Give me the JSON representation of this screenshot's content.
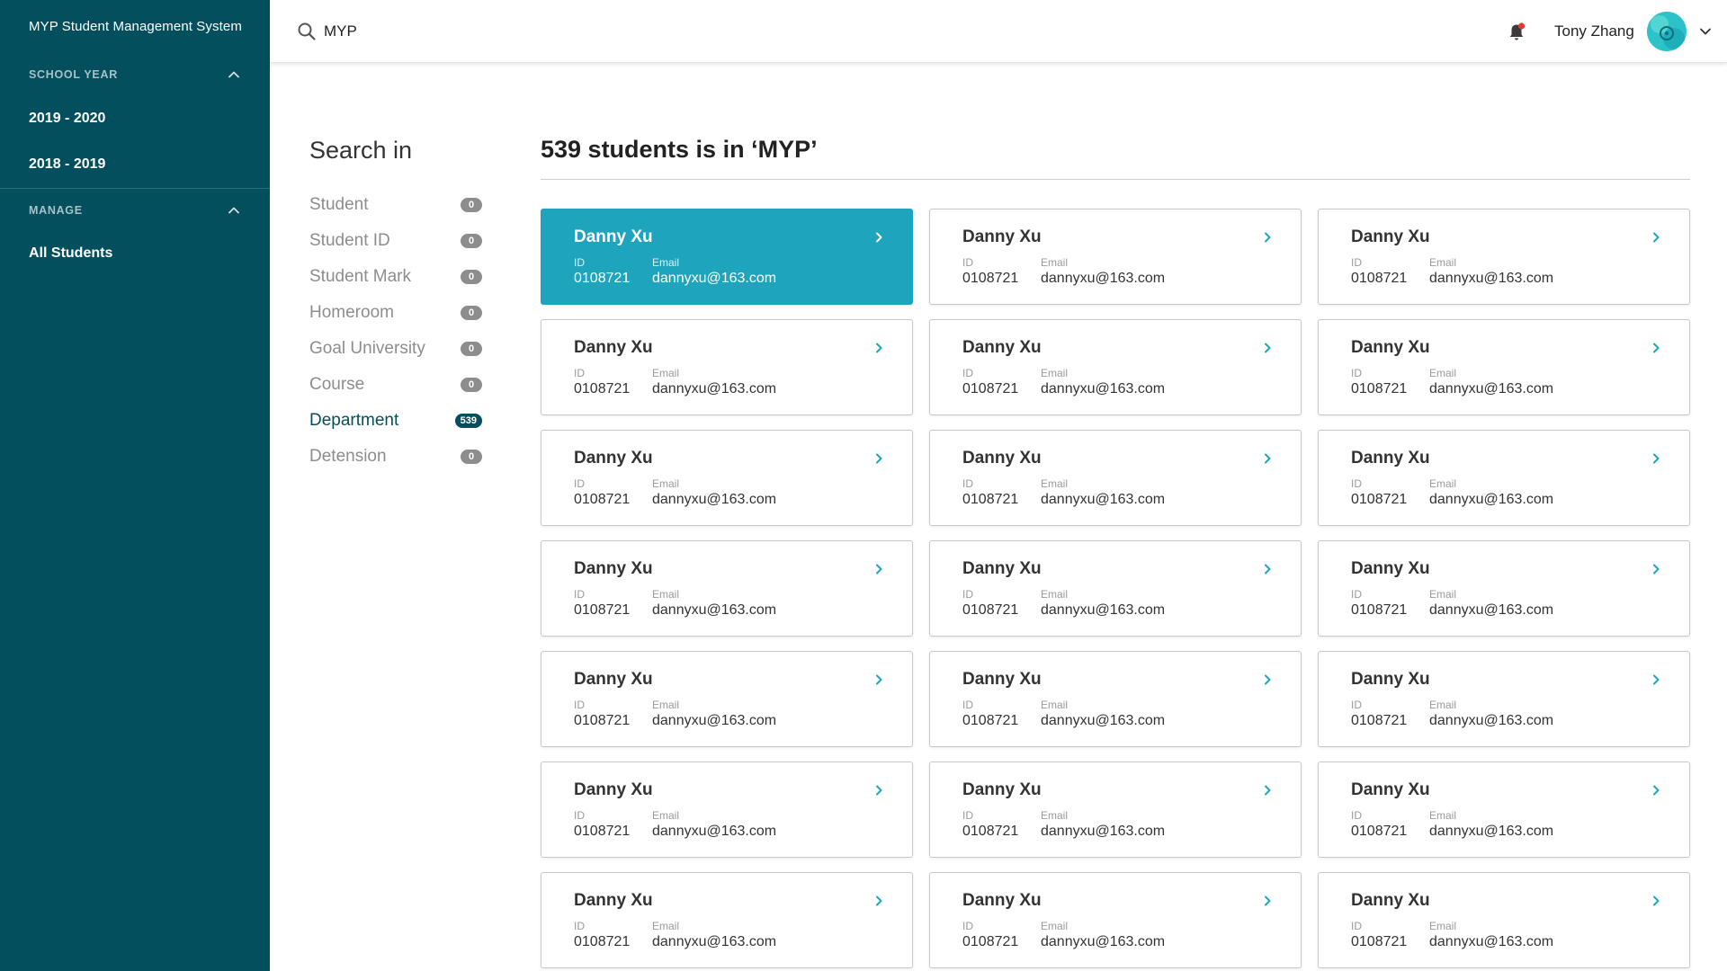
{
  "app": {
    "title": "MYP Student Management System"
  },
  "sidebar": {
    "school_year": {
      "label": "SCHOOL YEAR",
      "items": [
        "2019 - 2020",
        "2018 - 2019"
      ]
    },
    "manage": {
      "label": "MANAGE",
      "items": [
        "All Students"
      ]
    }
  },
  "header": {
    "search_value": "MYP",
    "user_name": "Tony Zhang",
    "notification_dot_color": "#e53935"
  },
  "search_in": {
    "title": "Search in",
    "filters": [
      {
        "label": "Student",
        "count": "0"
      },
      {
        "label": "Student ID",
        "count": "0"
      },
      {
        "label": "Student Mark",
        "count": "0"
      },
      {
        "label": "Homeroom",
        "count": "0"
      },
      {
        "label": "Goal University",
        "count": "0"
      },
      {
        "label": "Course",
        "count": "0"
      },
      {
        "label": "Department",
        "count": "539",
        "active": true
      },
      {
        "label": "Detension",
        "count": "0"
      }
    ]
  },
  "results": {
    "title": "539 students is in ‘MYP’",
    "id_label": "ID",
    "email_label": "Email",
    "students": [
      {
        "name": "Danny Xu",
        "id": "0108721",
        "email": "dannyxu@163.com",
        "selected": true
      },
      {
        "name": "Danny Xu",
        "id": "0108721",
        "email": "dannyxu@163.com"
      },
      {
        "name": "Danny Xu",
        "id": "0108721",
        "email": "dannyxu@163.com"
      },
      {
        "name": "Danny Xu",
        "id": "0108721",
        "email": "dannyxu@163.com"
      },
      {
        "name": "Danny Xu",
        "id": "0108721",
        "email": "dannyxu@163.com"
      },
      {
        "name": "Danny Xu",
        "id": "0108721",
        "email": "dannyxu@163.com"
      },
      {
        "name": "Danny Xu",
        "id": "0108721",
        "email": "dannyxu@163.com"
      },
      {
        "name": "Danny Xu",
        "id": "0108721",
        "email": "dannyxu@163.com"
      },
      {
        "name": "Danny Xu",
        "id": "0108721",
        "email": "dannyxu@163.com"
      },
      {
        "name": "Danny Xu",
        "id": "0108721",
        "email": "dannyxu@163.com"
      },
      {
        "name": "Danny Xu",
        "id": "0108721",
        "email": "dannyxu@163.com"
      },
      {
        "name": "Danny Xu",
        "id": "0108721",
        "email": "dannyxu@163.com"
      },
      {
        "name": "Danny Xu",
        "id": "0108721",
        "email": "dannyxu@163.com"
      },
      {
        "name": "Danny Xu",
        "id": "0108721",
        "email": "dannyxu@163.com"
      },
      {
        "name": "Danny Xu",
        "id": "0108721",
        "email": "dannyxu@163.com"
      },
      {
        "name": "Danny Xu",
        "id": "0108721",
        "email": "dannyxu@163.com"
      },
      {
        "name": "Danny Xu",
        "id": "0108721",
        "email": "dannyxu@163.com"
      },
      {
        "name": "Danny Xu",
        "id": "0108721",
        "email": "dannyxu@163.com"
      },
      {
        "name": "Danny Xu",
        "id": "0108721",
        "email": "dannyxu@163.com"
      },
      {
        "name": "Danny Xu",
        "id": "0108721",
        "email": "dannyxu@163.com"
      },
      {
        "name": "Danny Xu",
        "id": "0108721",
        "email": "dannyxu@163.com"
      }
    ]
  },
  "colors": {
    "sidebar_bg": "#044f5e",
    "accent": "#1ea5bd",
    "active_filter": "#044f5e",
    "inactive_badge": "#8d8d8d"
  },
  "icons": {
    "search": "search-icon",
    "bell": "bell-icon",
    "chevron_up": "chevron-up-icon",
    "chevron_down": "chevron-down-icon",
    "chevron_right": "chevron-right-icon"
  }
}
